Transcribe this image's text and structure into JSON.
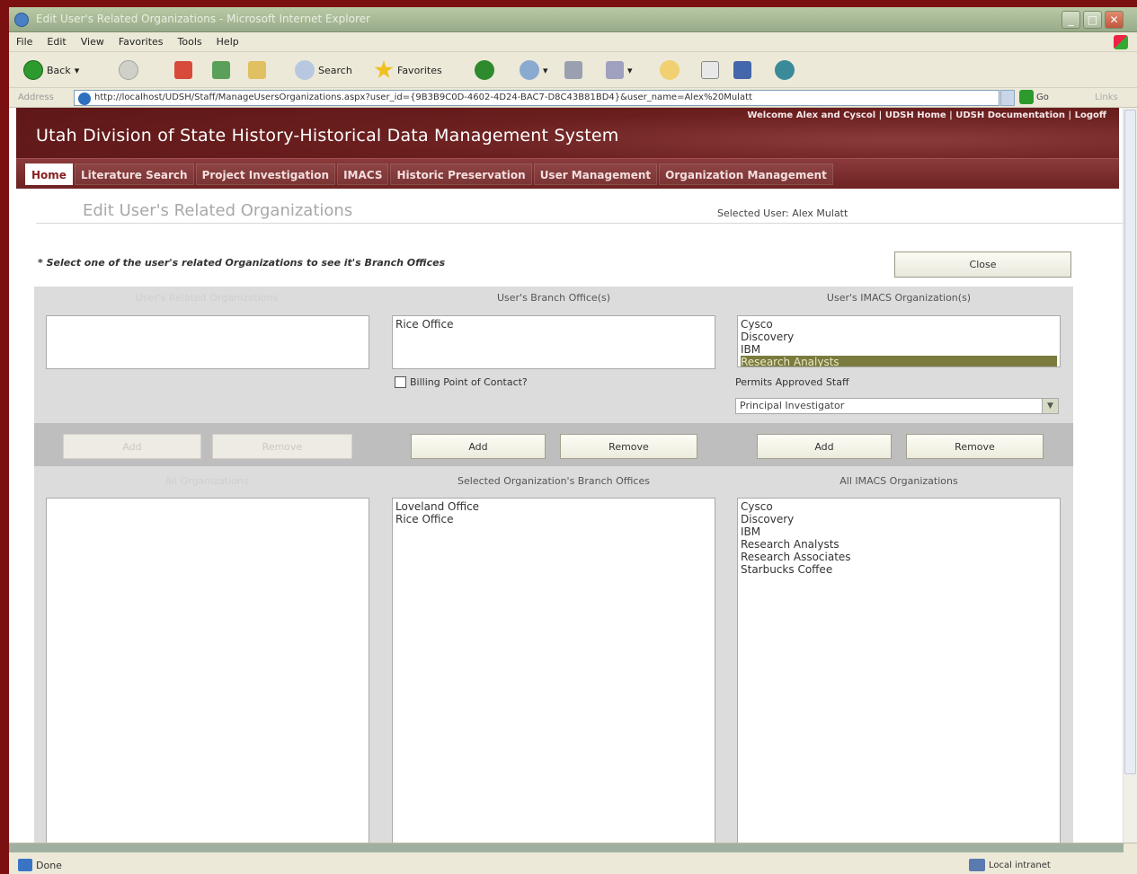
{
  "window": {
    "title": "Edit User's Related Organizations - Microsoft Internet Explorer"
  },
  "menu": [
    "File",
    "Edit",
    "View",
    "Favorites",
    "Tools",
    "Help"
  ],
  "toolbar": {
    "back_label": "Back",
    "search_label": "Search",
    "favorites_label": "Favorites"
  },
  "address": {
    "label": "Address",
    "url": "http://localhost/UDSH/Staff/ManageUsersOrganizations.aspx?user_id={9B3B9C0D-4602-4D24-BAC7-D8C43B81BD4}&user_name=Alex%20Mulatt",
    "go_label": "Go",
    "links_label": "Links"
  },
  "site": {
    "top_links": "Welcome Alex and Cyscol | UDSH Home | UDSH Documentation | Logoff",
    "title": "Utah Division of State History-Historical Data Management System",
    "nav": [
      "Home",
      "Literature Search",
      "Project Investigation",
      "IMACS",
      "Historic Preservation",
      "User Management",
      "Organization Management"
    ]
  },
  "page": {
    "title": "Edit User's Related Organizations",
    "selected_user": "Selected User: Alex Mulatt",
    "instruction": "* Select one of the user's related Organizations to see it's Branch Offices",
    "close_label": "Close"
  },
  "panel": {
    "col1_head": "User's Related Organizations",
    "col2_head": "User's Branch Office(s)",
    "col3_head": "User's IMACS Organization(s)",
    "branch_offices": [
      "Rice Office"
    ],
    "imacs_orgs": [
      "Cysco",
      "Discovery",
      "IBM",
      "Research Analysts"
    ],
    "imacs_selected": "Research Analysts",
    "billing_label": "Billing Point of Contact?",
    "permits_label": "Permits Approved Staff",
    "permit_value": "Principal Investigator",
    "buttons": {
      "add": "Add",
      "remove": "Remove"
    },
    "col1_bottom_head": "All Organizations",
    "col2_bottom_head": "Selected Organization's Branch Offices",
    "col3_bottom_head": "All IMACS Organizations",
    "selected_org_branches": [
      "Loveland Office",
      "Rice Office"
    ],
    "all_imacs": [
      "Cysco",
      "Discovery",
      "IBM",
      "Research Analysts",
      "Research Associates",
      "Starbucks Coffee"
    ]
  },
  "status": {
    "done": "Done",
    "zone": "Local intranet"
  }
}
